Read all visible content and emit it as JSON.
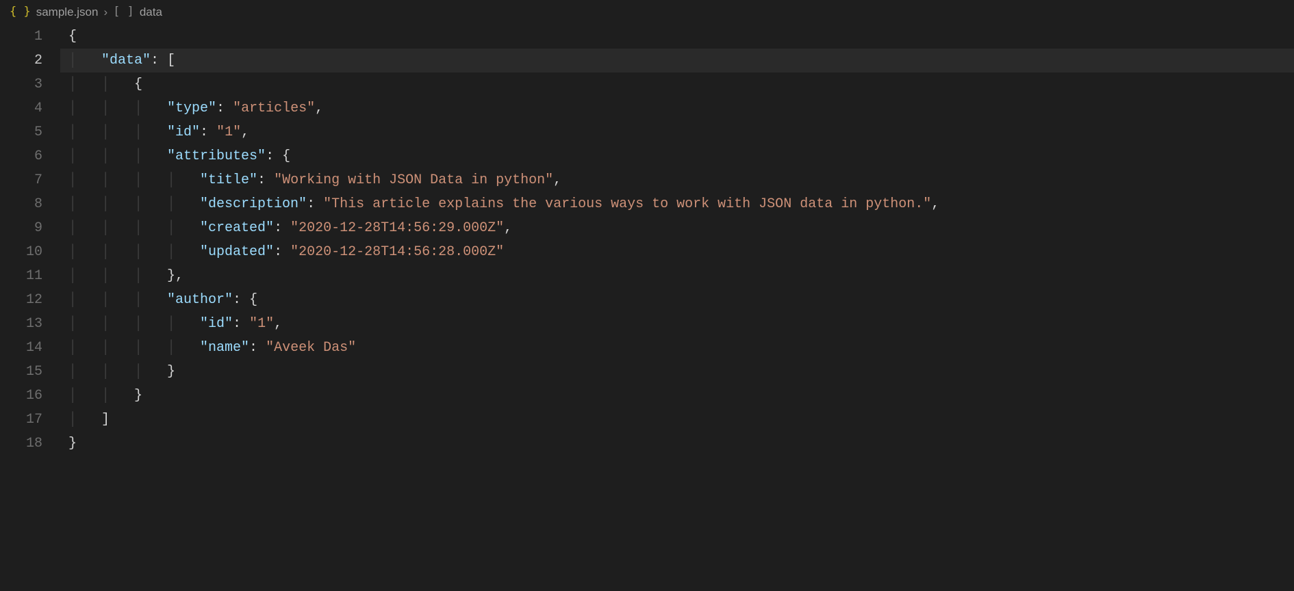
{
  "breadcrumb": {
    "file_icon": "{ }",
    "filename": "sample.json",
    "chevron": "›",
    "array_icon": "[ ]",
    "path_item": "data"
  },
  "editor": {
    "active_line": 2,
    "lines": [
      {
        "num": "1",
        "indent": "",
        "tokens": [
          {
            "cls": "t-brace",
            "txt": "{"
          }
        ]
      },
      {
        "num": "2",
        "indent": "    ",
        "tokens": [
          {
            "cls": "t-key",
            "txt": "\"data\""
          },
          {
            "cls": "t-punct",
            "txt": ": ["
          }
        ]
      },
      {
        "num": "3",
        "indent": "        ",
        "tokens": [
          {
            "cls": "t-brace",
            "txt": "{"
          }
        ]
      },
      {
        "num": "4",
        "indent": "            ",
        "tokens": [
          {
            "cls": "t-key",
            "txt": "\"type\""
          },
          {
            "cls": "t-punct",
            "txt": ": "
          },
          {
            "cls": "t-string",
            "txt": "\"articles\""
          },
          {
            "cls": "t-punct",
            "txt": ","
          }
        ]
      },
      {
        "num": "5",
        "indent": "            ",
        "tokens": [
          {
            "cls": "t-key",
            "txt": "\"id\""
          },
          {
            "cls": "t-punct",
            "txt": ": "
          },
          {
            "cls": "t-string",
            "txt": "\"1\""
          },
          {
            "cls": "t-punct",
            "txt": ","
          }
        ]
      },
      {
        "num": "6",
        "indent": "            ",
        "tokens": [
          {
            "cls": "t-key",
            "txt": "\"attributes\""
          },
          {
            "cls": "t-punct",
            "txt": ": "
          },
          {
            "cls": "t-brace",
            "txt": "{"
          }
        ]
      },
      {
        "num": "7",
        "indent": "                ",
        "tokens": [
          {
            "cls": "t-key",
            "txt": "\"title\""
          },
          {
            "cls": "t-punct",
            "txt": ": "
          },
          {
            "cls": "t-string",
            "txt": "\"Working with JSON Data in python\""
          },
          {
            "cls": "t-punct",
            "txt": ","
          }
        ]
      },
      {
        "num": "8",
        "indent": "                ",
        "tokens": [
          {
            "cls": "t-key",
            "txt": "\"description\""
          },
          {
            "cls": "t-punct",
            "txt": ": "
          },
          {
            "cls": "t-string",
            "txt": "\"This article explains the various ways to work with JSON data in python.\""
          },
          {
            "cls": "t-punct",
            "txt": ","
          }
        ]
      },
      {
        "num": "9",
        "indent": "                ",
        "tokens": [
          {
            "cls": "t-key",
            "txt": "\"created\""
          },
          {
            "cls": "t-punct",
            "txt": ": "
          },
          {
            "cls": "t-string",
            "txt": "\"2020-12-28T14:56:29.000Z\""
          },
          {
            "cls": "t-punct",
            "txt": ","
          }
        ]
      },
      {
        "num": "10",
        "indent": "                ",
        "tokens": [
          {
            "cls": "t-key",
            "txt": "\"updated\""
          },
          {
            "cls": "t-punct",
            "txt": ": "
          },
          {
            "cls": "t-string",
            "txt": "\"2020-12-28T14:56:28.000Z\""
          }
        ]
      },
      {
        "num": "11",
        "indent": "            ",
        "tokens": [
          {
            "cls": "t-brace",
            "txt": "}"
          },
          {
            "cls": "t-punct",
            "txt": ","
          }
        ]
      },
      {
        "num": "12",
        "indent": "            ",
        "tokens": [
          {
            "cls": "t-key",
            "txt": "\"author\""
          },
          {
            "cls": "t-punct",
            "txt": ": "
          },
          {
            "cls": "t-brace",
            "txt": "{"
          }
        ]
      },
      {
        "num": "13",
        "indent": "                ",
        "tokens": [
          {
            "cls": "t-key",
            "txt": "\"id\""
          },
          {
            "cls": "t-punct",
            "txt": ": "
          },
          {
            "cls": "t-string",
            "txt": "\"1\""
          },
          {
            "cls": "t-punct",
            "txt": ","
          }
        ]
      },
      {
        "num": "14",
        "indent": "                ",
        "tokens": [
          {
            "cls": "t-key",
            "txt": "\"name\""
          },
          {
            "cls": "t-punct",
            "txt": ": "
          },
          {
            "cls": "t-string",
            "txt": "\"Aveek Das\""
          }
        ]
      },
      {
        "num": "15",
        "indent": "            ",
        "tokens": [
          {
            "cls": "t-brace",
            "txt": "}"
          }
        ]
      },
      {
        "num": "16",
        "indent": "        ",
        "tokens": [
          {
            "cls": "t-brace",
            "txt": "}"
          }
        ]
      },
      {
        "num": "17",
        "indent": "    ",
        "tokens": [
          {
            "cls": "t-punct",
            "txt": "]"
          }
        ]
      },
      {
        "num": "18",
        "indent": "",
        "tokens": [
          {
            "cls": "t-brace",
            "txt": "}"
          }
        ]
      }
    ]
  }
}
